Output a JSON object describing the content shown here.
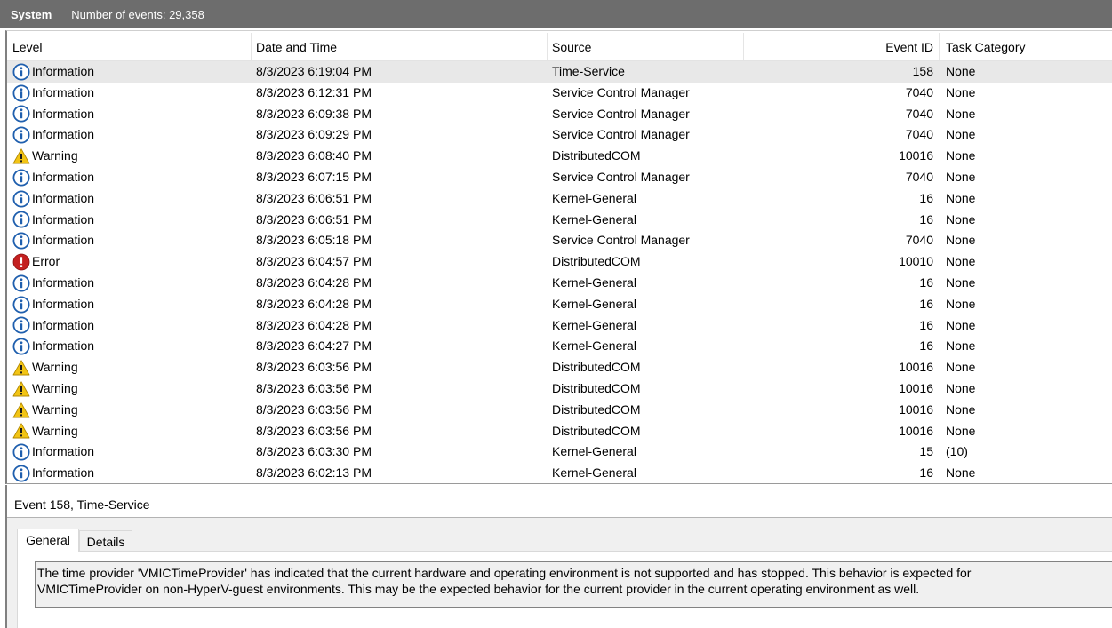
{
  "window": {
    "log_name": "System",
    "event_count_label": "Number of events: 29,358"
  },
  "columns": {
    "level": "Level",
    "date": "Date and Time",
    "source": "Source",
    "event_id": "Event ID",
    "task": "Task Category"
  },
  "icons": {
    "Information": "info-icon",
    "Warning": "warning-icon",
    "Error": "error-icon"
  },
  "colors": {
    "info": "#1f5fae",
    "warning": "#f2c414",
    "error": "#c42020",
    "selection": "#e8e8e8",
    "titlebar": "#6d6d6d"
  },
  "events": [
    {
      "level": "Information",
      "date": "8/3/2023 6:19:04 PM",
      "source": "Time-Service",
      "event_id": "158",
      "task": "None",
      "selected": true
    },
    {
      "level": "Information",
      "date": "8/3/2023 6:12:31 PM",
      "source": "Service Control Manager",
      "event_id": "7040",
      "task": "None"
    },
    {
      "level": "Information",
      "date": "8/3/2023 6:09:38 PM",
      "source": "Service Control Manager",
      "event_id": "7040",
      "task": "None"
    },
    {
      "level": "Information",
      "date": "8/3/2023 6:09:29 PM",
      "source": "Service Control Manager",
      "event_id": "7040",
      "task": "None"
    },
    {
      "level": "Warning",
      "date": "8/3/2023 6:08:40 PM",
      "source": "DistributedCOM",
      "event_id": "10016",
      "task": "None"
    },
    {
      "level": "Information",
      "date": "8/3/2023 6:07:15 PM",
      "source": "Service Control Manager",
      "event_id": "7040",
      "task": "None"
    },
    {
      "level": "Information",
      "date": "8/3/2023 6:06:51 PM",
      "source": "Kernel-General",
      "event_id": "16",
      "task": "None"
    },
    {
      "level": "Information",
      "date": "8/3/2023 6:06:51 PM",
      "source": "Kernel-General",
      "event_id": "16",
      "task": "None"
    },
    {
      "level": "Information",
      "date": "8/3/2023 6:05:18 PM",
      "source": "Service Control Manager",
      "event_id": "7040",
      "task": "None"
    },
    {
      "level": "Error",
      "date": "8/3/2023 6:04:57 PM",
      "source": "DistributedCOM",
      "event_id": "10010",
      "task": "None"
    },
    {
      "level": "Information",
      "date": "8/3/2023 6:04:28 PM",
      "source": "Kernel-General",
      "event_id": "16",
      "task": "None"
    },
    {
      "level": "Information",
      "date": "8/3/2023 6:04:28 PM",
      "source": "Kernel-General",
      "event_id": "16",
      "task": "None"
    },
    {
      "level": "Information",
      "date": "8/3/2023 6:04:28 PM",
      "source": "Kernel-General",
      "event_id": "16",
      "task": "None"
    },
    {
      "level": "Information",
      "date": "8/3/2023 6:04:27 PM",
      "source": "Kernel-General",
      "event_id": "16",
      "task": "None"
    },
    {
      "level": "Warning",
      "date": "8/3/2023 6:03:56 PM",
      "source": "DistributedCOM",
      "event_id": "10016",
      "task": "None"
    },
    {
      "level": "Warning",
      "date": "8/3/2023 6:03:56 PM",
      "source": "DistributedCOM",
      "event_id": "10016",
      "task": "None"
    },
    {
      "level": "Warning",
      "date": "8/3/2023 6:03:56 PM",
      "source": "DistributedCOM",
      "event_id": "10016",
      "task": "None"
    },
    {
      "level": "Warning",
      "date": "8/3/2023 6:03:56 PM",
      "source": "DistributedCOM",
      "event_id": "10016",
      "task": "None"
    },
    {
      "level": "Information",
      "date": "8/3/2023 6:03:30 PM",
      "source": "Kernel-General",
      "event_id": "15",
      "task": "(10)"
    },
    {
      "level": "Information",
      "date": "8/3/2023 6:02:13 PM",
      "source": "Kernel-General",
      "event_id": "16",
      "task": "None"
    }
  ],
  "detail": {
    "title": "Event 158, Time-Service",
    "tabs": [
      "General",
      "Details"
    ],
    "active_tab": "General",
    "description_line1": "The time provider 'VMICTimeProvider' has indicated that the current hardware and operating environment is not supported and has stopped. This behavior is expected for",
    "description_line2": "VMICTimeProvider on non-HyperV-guest environments. This may be the expected behavior for the current provider in the current operating environment as well."
  }
}
